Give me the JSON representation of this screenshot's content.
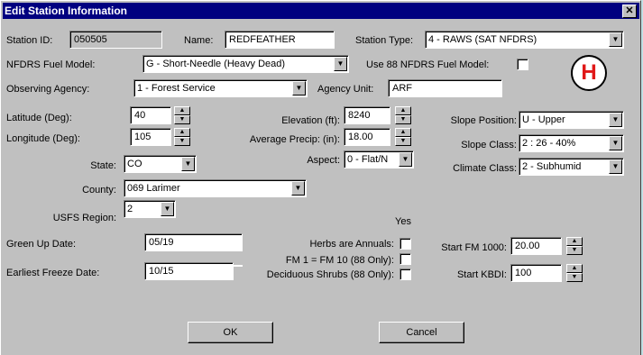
{
  "window": {
    "title": "Edit Station Information",
    "close_icon": "✕"
  },
  "station_id": {
    "label": "Station ID:",
    "value": "050505"
  },
  "name": {
    "label": "Name:",
    "value": "REDFEATHER"
  },
  "station_type": {
    "label": "Station Type:",
    "value": "4 - RAWS (SAT NFDRS)"
  },
  "fuel_model": {
    "label": "NFDRS Fuel Model:",
    "value": "G - Short-Needle (Heavy Dead)"
  },
  "use88": {
    "label": "Use 88 NFDRS Fuel Model:",
    "checked": false
  },
  "agency": {
    "label": "Observing Agency:",
    "value": "1 - Forest Service"
  },
  "agency_unit": {
    "label": "Agency Unit:",
    "value": "ARF"
  },
  "latitude": {
    "label": "Latitude (Deg):",
    "value": "40"
  },
  "longitude": {
    "label": "Longitude (Deg):",
    "value": "105"
  },
  "elevation": {
    "label": "Elevation (ft):",
    "value": "8240"
  },
  "precip": {
    "label": "Average Precip: (in):",
    "value": "18.00"
  },
  "aspect": {
    "label": "Aspect:",
    "value": "0 - Flat/N"
  },
  "slope_position": {
    "label": "Slope Position:",
    "value": "U - Upper"
  },
  "slope_class": {
    "label": "Slope Class:",
    "value": "2 : 26 - 40%"
  },
  "climate_class": {
    "label": "Climate Class:",
    "value": "2 - Subhumid"
  },
  "state": {
    "label": "State:",
    "value": "CO"
  },
  "county": {
    "label": "County:",
    "value": "069 Larimer"
  },
  "usfs_region": {
    "label": "USFS Region:",
    "value": "2"
  },
  "yes_header": "Yes",
  "green_up": {
    "label": "Green Up Date:",
    "value": "05/19"
  },
  "freeze": {
    "label": "Earliest Freeze Date:",
    "value": "10/15"
  },
  "herbs": {
    "label": "Herbs are Annuals:",
    "checked": false
  },
  "fm1": {
    "label": "FM 1 = FM 10 (88 Only):",
    "checked": false
  },
  "shrubs": {
    "label": "Deciduous Shrubs (88 Only):",
    "checked": false
  },
  "start_fm1000": {
    "label": "Start FM 1000:",
    "value": "20.00"
  },
  "start_kbdi": {
    "label": "Start KBDI:",
    "value": "100"
  },
  "buttons": {
    "ok": "OK",
    "cancel": "Cancel"
  },
  "overlay_badge": "H"
}
